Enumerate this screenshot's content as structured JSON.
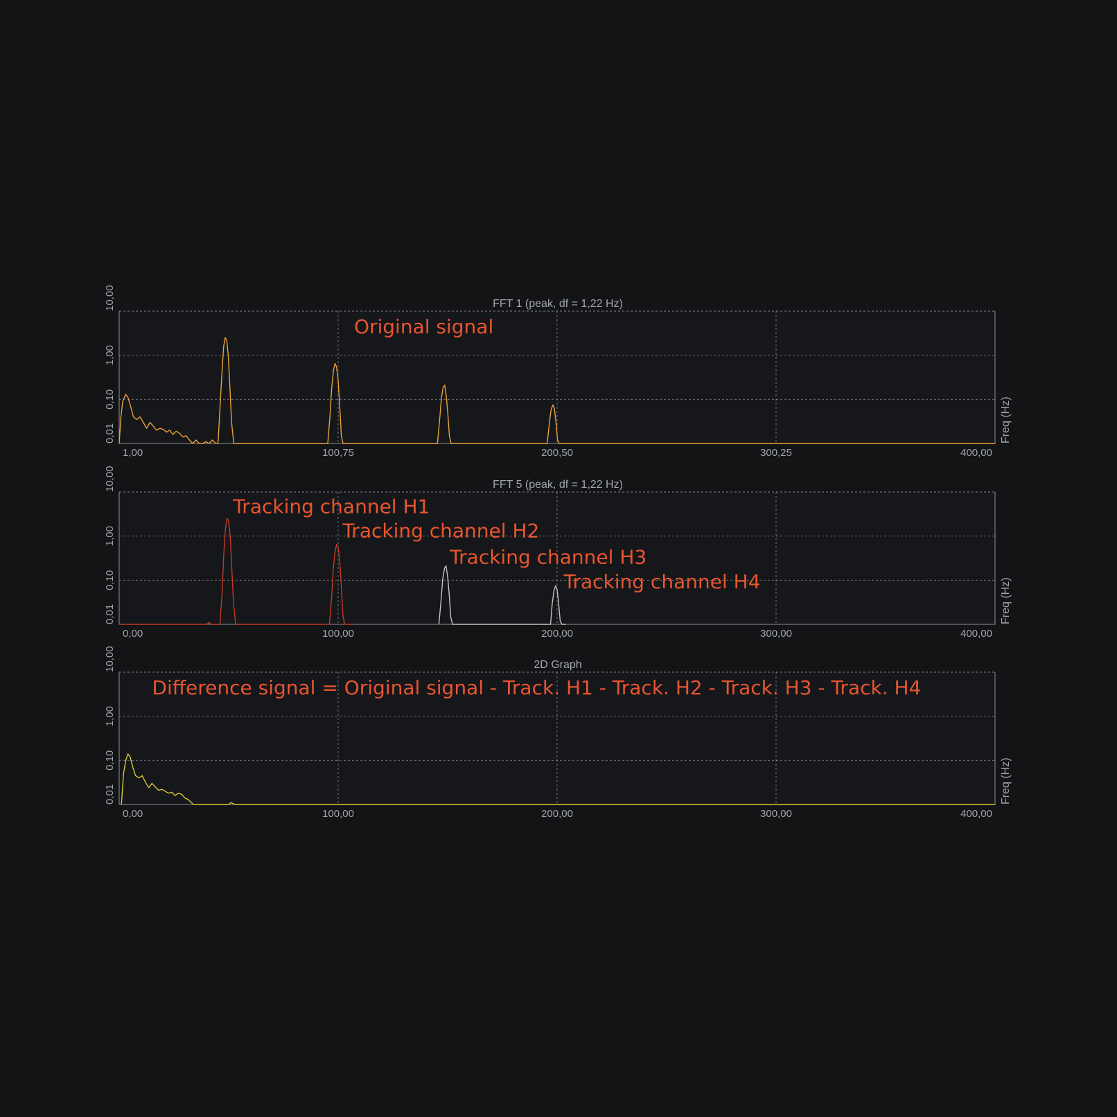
{
  "chart_data": [
    {
      "type": "line",
      "title": "FFT 1 (peak, df = 1,22 Hz)",
      "ylabel": "Freq (Hz)",
      "yscale": "log",
      "ylim": [
        0.01,
        10
      ],
      "yticks": [
        "0,01",
        "0,10",
        "1,00",
        "10,00"
      ],
      "xlim": [
        1,
        400
      ],
      "xticks": [
        {
          "value": 1,
          "label": "1,00"
        },
        {
          "value": 100.75,
          "label": "100,75"
        },
        {
          "value": 200.5,
          "label": "200,50"
        },
        {
          "value": 300.25,
          "label": "300,25"
        },
        {
          "value": 400,
          "label": "400,00"
        }
      ],
      "grid": true,
      "annotations": [
        {
          "text": "Original signal",
          "x": 108,
          "y": 4.5
        }
      ],
      "series": [
        {
          "color": "#e8a33a",
          "x": [
            1,
            1.8,
            2.6,
            4,
            5,
            6.2,
            7.5,
            9,
            10.5,
            12,
            13.5,
            15,
            16.5,
            18,
            19.5,
            21,
            22.5,
            24,
            25.5,
            27,
            28.5,
            30,
            31.5,
            33,
            34.5,
            36,
            37.5,
            39,
            40.5,
            42,
            43.5,
            45,
            46,
            46.8,
            47.8,
            48.6,
            49.3,
            50,
            50.7,
            51.4,
            52.2,
            53.2,
            54,
            55,
            96,
            97,
            97.8,
            98.6,
            99.3,
            100,
            100.7,
            101.4,
            102.2,
            103,
            104,
            146,
            147,
            147.8,
            148.6,
            149.3,
            150,
            150.7,
            151.4,
            152.2,
            153,
            154,
            196,
            197,
            197.8,
            198.6,
            199.3,
            200,
            200.7,
            201.4,
            202.2,
            203,
            204,
            250,
            400
          ],
          "y": [
            0.01,
            0.04,
            0.09,
            0.13,
            0.11,
            0.07,
            0.04,
            0.035,
            0.04,
            0.03,
            0.022,
            0.03,
            0.025,
            0.02,
            0.022,
            0.021,
            0.018,
            0.02,
            0.016,
            0.019,
            0.017,
            0.014,
            0.015,
            0.012,
            0.01,
            0.012,
            0.01,
            0.01,
            0.011,
            0.01,
            0.012,
            0.01,
            0.01,
            0.05,
            0.4,
            1.6,
            2.5,
            2.2,
            1.0,
            0.2,
            0.03,
            0.01,
            0.01,
            0.01,
            0.01,
            0.04,
            0.18,
            0.45,
            0.65,
            0.55,
            0.3,
            0.08,
            0.015,
            0.01,
            0.01,
            0.01,
            0.035,
            0.11,
            0.19,
            0.21,
            0.12,
            0.05,
            0.015,
            0.01,
            0.01,
            0.01,
            0.01,
            0.03,
            0.06,
            0.075,
            0.06,
            0.03,
            0.012,
            0.01,
            0.01,
            0.01,
            0.01,
            0.01,
            0.01
          ]
        }
      ]
    },
    {
      "type": "line",
      "title": "FFT 5 (peak, df = 1,22 Hz)",
      "ylabel": "Freq (Hz)",
      "yscale": "log",
      "ylim": [
        0.01,
        10
      ],
      "yticks": [
        "0,01",
        "0,10",
        "1,00",
        "10,00"
      ],
      "xlim": [
        0,
        400
      ],
      "xticks": [
        {
          "value": 0,
          "label": "0,00"
        },
        {
          "value": 100,
          "label": "100,00"
        },
        {
          "value": 200,
          "label": "200,00"
        },
        {
          "value": 300,
          "label": "300,00"
        },
        {
          "value": 400,
          "label": "400,00"
        }
      ],
      "grid": true,
      "annotations": [
        {
          "text": "Tracking channel H1",
          "x": 52,
          "y": 4.8
        },
        {
          "text": "Tracking channel H2",
          "x": 102,
          "y": 1.35
        },
        {
          "text": "Tracking channel H3",
          "x": 151,
          "y": 0.34
        },
        {
          "text": "Tracking channel H4",
          "x": 203,
          "y": 0.095
        }
      ],
      "series": [
        {
          "color": "#c23a26",
          "x": [
            0,
            40,
            41,
            42,
            43,
            46,
            47,
            47.8,
            48.6,
            49.3,
            50,
            50.7,
            51.4,
            52.2,
            53.2,
            54,
            56,
            96,
            97,
            97.8,
            98.6,
            99.3,
            100,
            100.7,
            101.4,
            102.2,
            103,
            104,
            106
          ],
          "y": [
            0.01,
            0.01,
            0.011,
            0.01,
            0.01,
            0.01,
            0.05,
            0.4,
            1.6,
            2.5,
            2.2,
            1.0,
            0.2,
            0.03,
            0.01,
            0.01,
            0.01,
            0.01,
            0.04,
            0.18,
            0.45,
            0.65,
            0.55,
            0.3,
            0.08,
            0.015,
            0.01,
            0.01,
            0.01
          ]
        },
        {
          "color": "#c9c3bd",
          "x": [
            146,
            147,
            147.8,
            148.6,
            149.3,
            150,
            150.7,
            151.4,
            152.2,
            153,
            154,
            196,
            197,
            197.8,
            198.6,
            199.3,
            200,
            200.7,
            201.4,
            202.2,
            203,
            204
          ],
          "y": [
            0.01,
            0.035,
            0.11,
            0.19,
            0.21,
            0.12,
            0.05,
            0.015,
            0.01,
            0.01,
            0.01,
            0.01,
            0.01,
            0.03,
            0.06,
            0.075,
            0.06,
            0.03,
            0.012,
            0.01,
            0.01,
            0.01
          ]
        }
      ]
    },
    {
      "type": "line",
      "title": "2D Graph",
      "ylabel": "Freq (Hz)",
      "yscale": "log",
      "ylim": [
        0.01,
        10
      ],
      "yticks": [
        "0,01",
        "0,10",
        "1,00",
        "10,00"
      ],
      "xlim": [
        0,
        400
      ],
      "xticks": [
        {
          "value": 0,
          "label": "0,00"
        },
        {
          "value": 100,
          "label": "100,00"
        },
        {
          "value": 200,
          "label": "200,00"
        },
        {
          "value": 300,
          "label": "300,00"
        },
        {
          "value": 400,
          "label": "400,00"
        }
      ],
      "grid": true,
      "annotations": [
        {
          "text": "Difference signal = Original signal - Track. H1 - Track. H2 - Track. H3 - Track. H4",
          "x": 15,
          "y": 4.5
        }
      ],
      "series": [
        {
          "color": "#d8c832",
          "x": [
            1,
            2,
            3,
            4,
            5,
            6.2,
            7.5,
            9,
            10.5,
            12,
            13.5,
            15,
            16.5,
            18,
            19.5,
            21,
            22.5,
            24,
            25.5,
            27,
            28.5,
            30,
            31.5,
            33,
            34,
            35,
            50,
            51,
            52,
            53,
            400
          ],
          "y": [
            0.01,
            0.05,
            0.1,
            0.14,
            0.12,
            0.07,
            0.045,
            0.04,
            0.045,
            0.032,
            0.024,
            0.03,
            0.025,
            0.021,
            0.022,
            0.02,
            0.018,
            0.019,
            0.016,
            0.018,
            0.017,
            0.014,
            0.013,
            0.011,
            0.01,
            0.01,
            0.01,
            0.011,
            0.0105,
            0.01,
            0.01
          ]
        }
      ]
    }
  ]
}
